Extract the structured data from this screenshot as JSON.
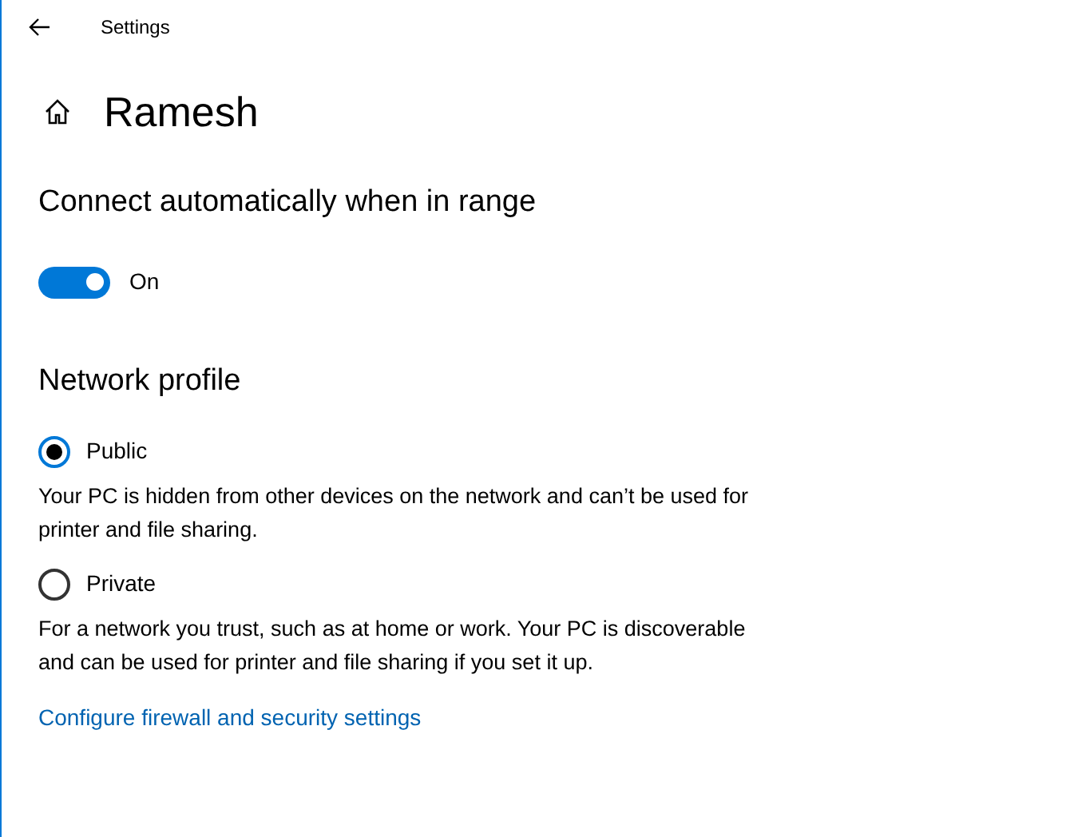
{
  "window": {
    "title": "Settings"
  },
  "page": {
    "title": "Ramesh"
  },
  "connect": {
    "heading": "Connect automatically when in range",
    "on": true,
    "state_label": "On"
  },
  "network_profile": {
    "heading": "Network profile",
    "options": [
      {
        "label": "Public",
        "selected": true,
        "description": "Your PC is hidden from other devices on the network and can’t be used for printer and file sharing."
      },
      {
        "label": "Private",
        "selected": false,
        "description": "For a network you trust, such as at home or work. Your PC is discoverable and can be used for printer and file sharing if you set it up."
      }
    ]
  },
  "link": "Configure firewall and security settings"
}
